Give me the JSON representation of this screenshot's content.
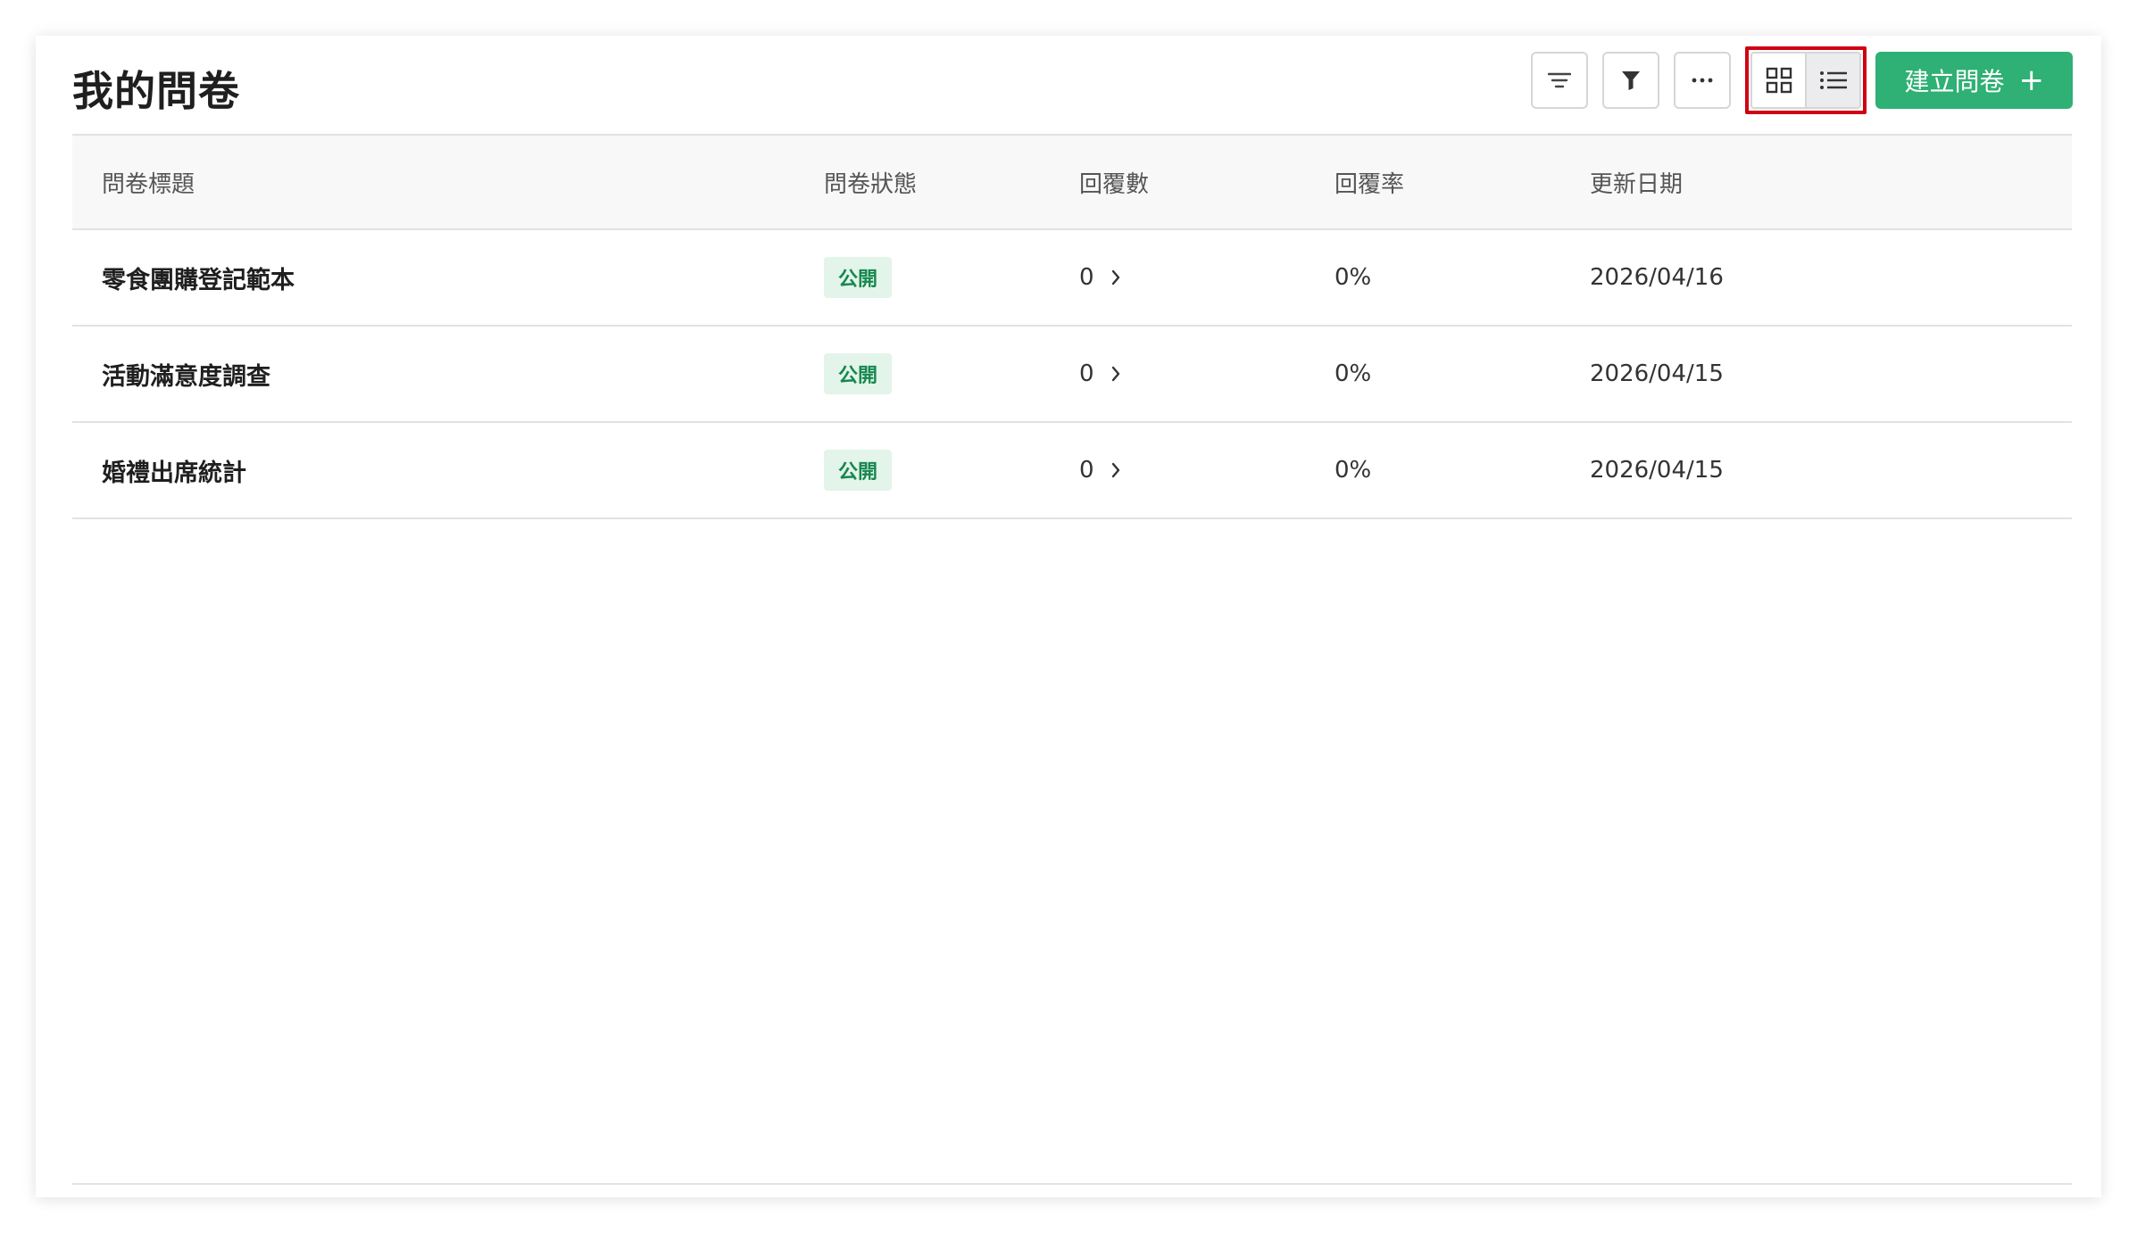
{
  "page": {
    "title": "我的問卷"
  },
  "toolbar": {
    "sort_icon": "sort-lines-icon",
    "filter_icon": "funnel-icon",
    "more_icon": "ellipsis-icon",
    "grid_view_icon": "grid-icon",
    "list_view_icon": "list-icon",
    "create_label": "建立問卷",
    "create_plus": "+"
  },
  "table": {
    "headers": [
      "問卷標題",
      "問卷狀態",
      "回覆數",
      "回覆率",
      "更新日期"
    ],
    "rows": [
      {
        "title": "零食團購登記範本",
        "status": "公開",
        "responses": "0",
        "rate": "0%",
        "updated": "2026/04/16"
      },
      {
        "title": "活動滿意度調查",
        "status": "公開",
        "responses": "0",
        "rate": "0%",
        "updated": "2026/04/15"
      },
      {
        "title": "婚禮出席統計",
        "status": "公開",
        "responses": "0",
        "rate": "0%",
        "updated": "2026/04/15"
      }
    ]
  },
  "colors": {
    "accent": "#2fb074",
    "badge_bg": "#e3f4ea",
    "badge_text": "#17884f",
    "highlight": "#d00012"
  }
}
